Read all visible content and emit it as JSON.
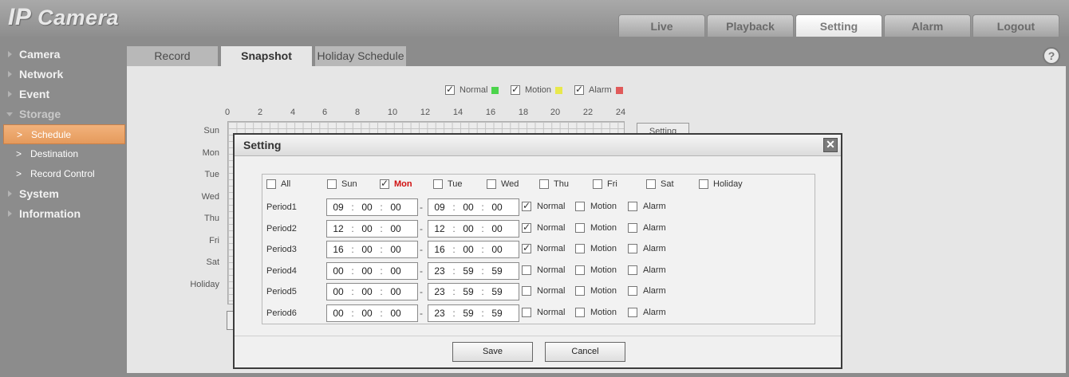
{
  "app": {
    "logo_prefix": "IP",
    "logo_suffix": "Camera"
  },
  "nav_tabs": [
    {
      "label": "Live",
      "active": false
    },
    {
      "label": "Playback",
      "active": false
    },
    {
      "label": "Setting",
      "active": true
    },
    {
      "label": "Alarm",
      "active": false
    },
    {
      "label": "Logout",
      "active": false
    }
  ],
  "sidebar": {
    "items": [
      {
        "label": "Camera"
      },
      {
        "label": "Network"
      },
      {
        "label": "Event"
      },
      {
        "label": "Storage"
      },
      {
        "label": "System"
      },
      {
        "label": "Information"
      }
    ],
    "storage_sub": [
      {
        "label": "Schedule",
        "active": true
      },
      {
        "label": "Destination",
        "active": false
      },
      {
        "label": "Record Control",
        "active": false
      }
    ]
  },
  "sub_tabs": [
    {
      "label": "Record",
      "active": false
    },
    {
      "label": "Snapshot",
      "active": true
    },
    {
      "label": "Holiday Schedule",
      "active": false
    }
  ],
  "help_icon": "question-icon",
  "legend": [
    {
      "label": "Normal",
      "checked": true,
      "color": "#4cd44c"
    },
    {
      "label": "Motion",
      "checked": true,
      "color": "#e8e84c"
    },
    {
      "label": "Alarm",
      "checked": true,
      "color": "#e05a5a"
    }
  ],
  "hours": [
    "0",
    "2",
    "4",
    "6",
    "8",
    "10",
    "12",
    "14",
    "16",
    "18",
    "20",
    "22",
    "24"
  ],
  "days": [
    "Sun",
    "Mon",
    "Tue",
    "Wed",
    "Thu",
    "Fri",
    "Sat",
    "Holiday"
  ],
  "bg_setting_button": "Setting",
  "dialog": {
    "title": "Setting",
    "close_icon": "close-icon",
    "day_checks": [
      {
        "label": "All",
        "checked": false
      },
      {
        "label": "Sun",
        "checked": false
      },
      {
        "label": "Mon",
        "checked": true
      },
      {
        "label": "Tue",
        "checked": false
      },
      {
        "label": "Wed",
        "checked": false
      },
      {
        "label": "Thu",
        "checked": false
      },
      {
        "label": "Fri",
        "checked": false
      },
      {
        "label": "Sat",
        "checked": false
      },
      {
        "label": "Holiday",
        "checked": false
      }
    ],
    "periods": [
      {
        "label": "Period1",
        "start": [
          "09",
          "00",
          "00"
        ],
        "end": [
          "09",
          "00",
          "00"
        ],
        "normal": true,
        "motion": false,
        "alarm": false
      },
      {
        "label": "Period2",
        "start": [
          "12",
          "00",
          "00"
        ],
        "end": [
          "12",
          "00",
          "00"
        ],
        "normal": true,
        "motion": false,
        "alarm": false
      },
      {
        "label": "Period3",
        "start": [
          "16",
          "00",
          "00"
        ],
        "end": [
          "16",
          "00",
          "00"
        ],
        "normal": true,
        "motion": false,
        "alarm": false
      },
      {
        "label": "Period4",
        "start": [
          "00",
          "00",
          "00"
        ],
        "end": [
          "23",
          "59",
          "59"
        ],
        "normal": false,
        "motion": false,
        "alarm": false
      },
      {
        "label": "Period5",
        "start": [
          "00",
          "00",
          "00"
        ],
        "end": [
          "23",
          "59",
          "59"
        ],
        "normal": false,
        "motion": false,
        "alarm": false
      },
      {
        "label": "Period6",
        "start": [
          "00",
          "00",
          "00"
        ],
        "end": [
          "23",
          "59",
          "59"
        ],
        "normal": false,
        "motion": false,
        "alarm": false
      }
    ],
    "type_labels": {
      "normal": "Normal",
      "motion": "Motion",
      "alarm": "Alarm"
    },
    "save_label": "Save",
    "cancel_label": "Cancel"
  }
}
